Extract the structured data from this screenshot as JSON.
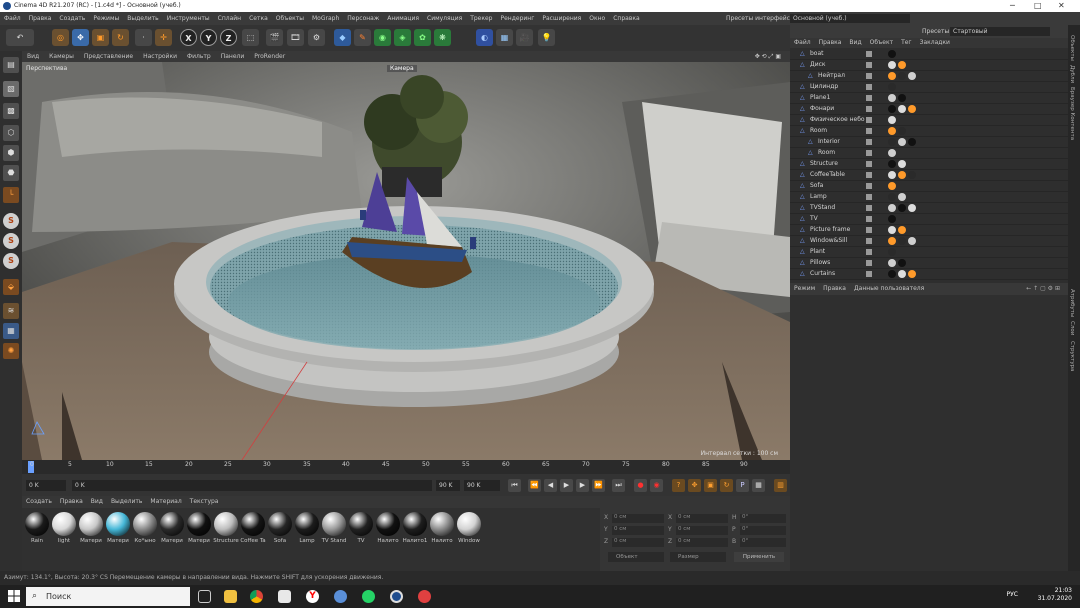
{
  "window": {
    "title": "Cinema 4D R21.207 (RC) - [1.c4d *] - Основной (учеб.)"
  },
  "menu": [
    "Файл",
    "Правка",
    "Создать",
    "Режимы",
    "Выделить",
    "Инструменты",
    "Сплайн",
    "Сетка",
    "Объекты",
    "MoGraph",
    "Персонаж",
    "Анимация",
    "Симуляция",
    "Трекер",
    "Рендеринг",
    "Расширения",
    "Окно",
    "Справка"
  ],
  "layout": {
    "label": "Пресеты интерфейса:",
    "value": "Основной (учеб.)"
  },
  "viewport": {
    "menu": [
      "Вид",
      "Камеры",
      "Представление",
      "Настройки",
      "Фильтр",
      "Панели",
      "ProRender"
    ],
    "view_name": "Перспектива",
    "camera": "Камера",
    "grid": "Интервал сетки : 100 см"
  },
  "timeline": {
    "ticks": [
      "0",
      "5",
      "10",
      "15",
      "20",
      "25",
      "30",
      "35",
      "40",
      "45",
      "50",
      "55",
      "60",
      "65",
      "70",
      "75",
      "80",
      "85",
      "90"
    ],
    "start": "0 K",
    "current": "0 K",
    "end": "90 K",
    "end2": "90 K"
  },
  "materials": {
    "menu": [
      "Создать",
      "Правка",
      "Вид",
      "Выделить",
      "Материал",
      "Текстура"
    ],
    "items": [
      {
        "name": "Rain",
        "color": "#1a1a1a"
      },
      {
        "name": "light",
        "color": "#d8d8d8"
      },
      {
        "name": "Матери",
        "color": "#c8c8c8"
      },
      {
        "name": "Матери",
        "color": "#46b8d8"
      },
      {
        "name": "Ко*ыно",
        "color": "#8a8a8a"
      },
      {
        "name": "Матери",
        "color": "#2a2a2a"
      },
      {
        "name": "Матери",
        "color": "#101010"
      },
      {
        "name": "Structure",
        "color": "#bdbdbd"
      },
      {
        "name": "Coffee Ta",
        "color": "#141414"
      },
      {
        "name": "Sofa",
        "color": "#262626"
      },
      {
        "name": "Lamp",
        "color": "#1c1c1c"
      },
      {
        "name": "TV Stand",
        "color": "#9a9a9a"
      },
      {
        "name": "TV",
        "color": "#222222"
      },
      {
        "name": "Налито",
        "color": "#111111"
      },
      {
        "name": "Налито1",
        "color": "#1e1e1e"
      },
      {
        "name": "Налито",
        "color": "#8c8c8c"
      },
      {
        "name": "Window",
        "color": "#d2d2d2"
      }
    ]
  },
  "coords": {
    "rows": [
      {
        "a": "X",
        "av": "0 см",
        "b": "X",
        "bv": "0 см",
        "c": "H",
        "cv": "0°"
      },
      {
        "a": "Y",
        "av": "0 см",
        "b": "Y",
        "bv": "0 см",
        "c": "P",
        "cv": "0°"
      },
      {
        "a": "Z",
        "av": "0 см",
        "b": "Z",
        "bv": "0 см",
        "c": "B",
        "cv": "0°"
      }
    ],
    "mode1": "Объект",
    "mode2": "Размер",
    "apply": "Применить"
  },
  "objects": {
    "top_label": "Пресеты:",
    "top_value": "Стартовый",
    "menu": [
      "Файл",
      "Правка",
      "Вид",
      "Объект",
      "Тег",
      "Закладки"
    ],
    "rows": [
      {
        "name": "boat",
        "indent": 0
      },
      {
        "name": "Диск",
        "indent": 0
      },
      {
        "name": "Нейтрал",
        "indent": 1
      },
      {
        "name": "Цилиндр",
        "indent": 0
      },
      {
        "name": "Plane1",
        "indent": 0
      },
      {
        "name": "Фонари",
        "indent": 0
      },
      {
        "name": "Физическое небо",
        "indent": 0
      },
      {
        "name": "Room",
        "indent": 0
      },
      {
        "name": "Interior",
        "indent": 1
      },
      {
        "name": "Room",
        "indent": 1
      },
      {
        "name": "Structure",
        "indent": 0
      },
      {
        "name": "CoffeeTable",
        "indent": 0
      },
      {
        "name": "Sofa",
        "indent": 0
      },
      {
        "name": "Lamp",
        "indent": 0
      },
      {
        "name": "TVStand",
        "indent": 0
      },
      {
        "name": "TV",
        "indent": 0
      },
      {
        "name": "Picture frame",
        "indent": 0
      },
      {
        "name": "Window&Sill",
        "indent": 0
      },
      {
        "name": "Plant",
        "indent": 0
      },
      {
        "name": "Pillows",
        "indent": 0
      },
      {
        "name": "Curtains",
        "indent": 0
      }
    ]
  },
  "attributes": {
    "menu": [
      "Режим",
      "Правка",
      "Данные пользователя"
    ]
  },
  "sidetabs": [
    "Объекты",
    "Дубли",
    "Браузер Контента",
    "Атрибуты",
    "Слои",
    "Структура"
  ],
  "status": "Азимут: 134.1°, Высота: 20.3°   CS   Перемещение камеры в направлении вида. Нажмите SHIFT для ускорения движения.",
  "taskbar": {
    "search": "Поиск",
    "time": "21:03",
    "date": "31.07.2020",
    "lang": "РУС"
  }
}
